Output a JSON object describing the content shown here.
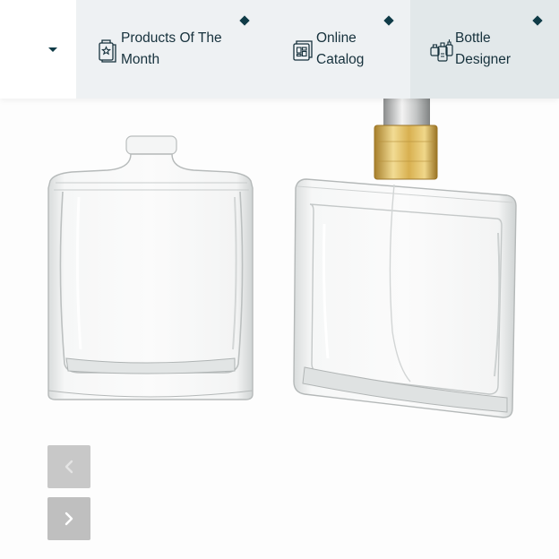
{
  "nav": {
    "items": [
      {
        "label_line1": "Products Of The",
        "label_line2": "Month",
        "icon": "star-bottle-icon"
      },
      {
        "label_line1": "Online",
        "label_line2": "Catalog",
        "icon": "catalog-icon"
      },
      {
        "label_line1": "Bottle",
        "label_line2": "Designer",
        "icon": "bottle-designer-icon"
      }
    ]
  },
  "slider": {
    "prev_icon": "chevron-left-icon",
    "next_icon": "chevron-right-icon"
  },
  "colors": {
    "nav_bg": "#eef1f3",
    "nav_active_bg": "#e2e8ea",
    "accent": "#0f3b47",
    "text": "#16313c",
    "gold": "#c9a24a"
  }
}
